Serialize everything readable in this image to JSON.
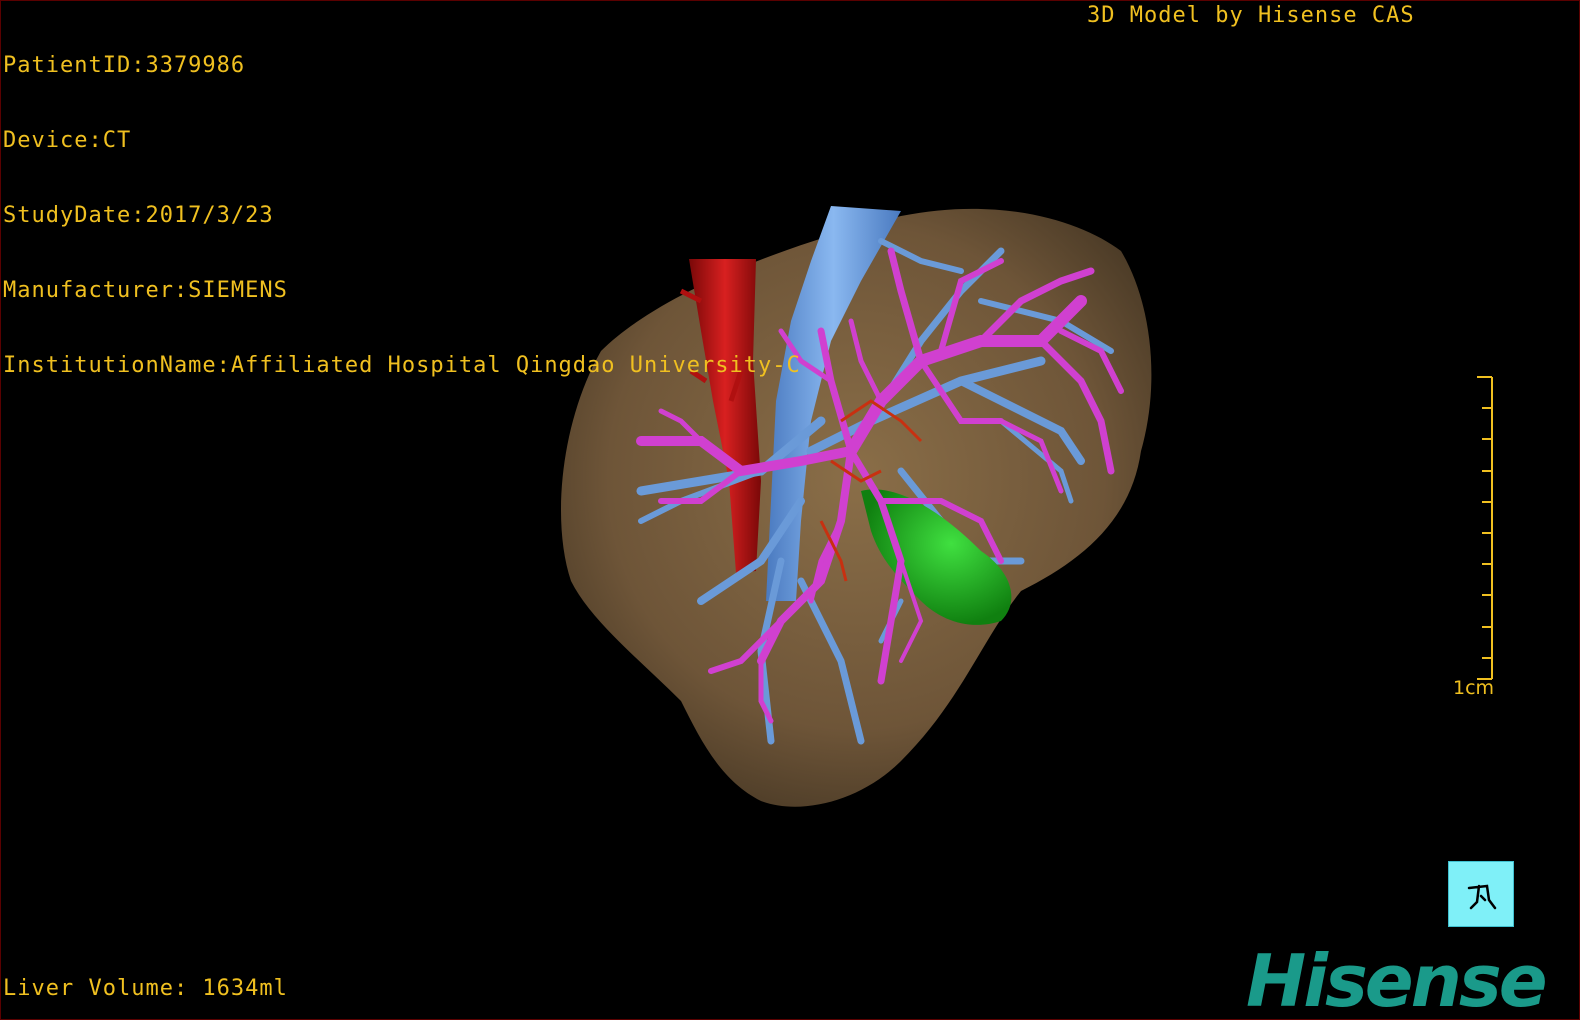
{
  "info": {
    "patient_id": "PatientID:3379986",
    "device": "Device:CT",
    "study_date": "StudyDate:2017/3/23",
    "manufacturer": "Manufacturer:SIEMENS",
    "institution": "InstitutionName:Affiliated Hospital Qingdao University-C"
  },
  "credit": "3D Model by Hisense CAS",
  "volume": "Liver Volume: 1634ml",
  "scale": {
    "label": "1cm",
    "ticks": 10
  },
  "orientation_button": {
    "icon": "orientation-figure-icon"
  },
  "logo": {
    "text": "Hisense"
  },
  "colors": {
    "text": "#f0c020",
    "liver": "#7a6040",
    "portal_vein": "#6a9ad8",
    "hepatic_vein": "#d040d0",
    "artery": "#c01010",
    "gallbladder": "#20c020",
    "logo": "#1a9a8a",
    "orient_button": "#7ff0f8"
  }
}
